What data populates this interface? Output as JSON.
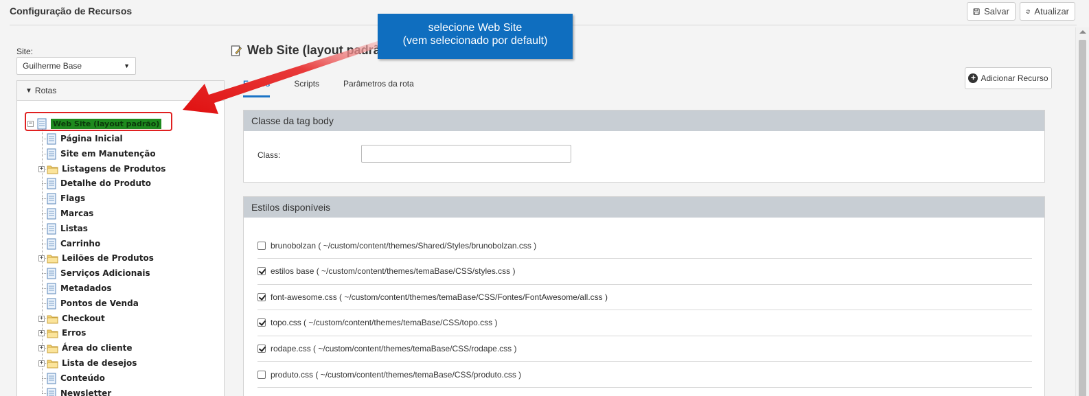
{
  "header": {
    "title": "Configuração de Recursos",
    "save_label": "Salvar",
    "refresh_label": "Atualizar"
  },
  "site": {
    "label": "Site:",
    "selected": "Guilherme Base"
  },
  "tree": {
    "header": "Rotas",
    "root": "Web Site (layout padrão)",
    "items": [
      {
        "label": "Página Inicial",
        "type": "page"
      },
      {
        "label": "Site em Manutenção",
        "type": "page"
      },
      {
        "label": "Listagens de Produtos",
        "type": "folder"
      },
      {
        "label": "Detalhe do Produto",
        "type": "page"
      },
      {
        "label": "Flags",
        "type": "page"
      },
      {
        "label": "Marcas",
        "type": "page"
      },
      {
        "label": "Listas",
        "type": "page"
      },
      {
        "label": "Carrinho",
        "type": "page"
      },
      {
        "label": "Leilões de Produtos",
        "type": "folder"
      },
      {
        "label": "Serviços Adicionais",
        "type": "page"
      },
      {
        "label": "Metadados",
        "type": "page"
      },
      {
        "label": "Pontos de Venda",
        "type": "page"
      },
      {
        "label": "Checkout",
        "type": "folder"
      },
      {
        "label": "Erros",
        "type": "folder"
      },
      {
        "label": "Área do cliente",
        "type": "folder"
      },
      {
        "label": "Lista de desejos",
        "type": "folder"
      },
      {
        "label": "Conteúdo",
        "type": "page"
      },
      {
        "label": "Newsletter",
        "type": "page"
      }
    ]
  },
  "main": {
    "title": "Web Site (layout padrão)",
    "tabs": [
      "Estilos",
      "Scripts",
      "Parâmetros da rota"
    ],
    "active_tab": "Estilos",
    "add_resource_label": "Adicionar Recurso",
    "body_class_panel": {
      "title": "Classe da tag body",
      "class_label": "Class:",
      "class_value": ""
    },
    "styles_panel": {
      "title": "Estilos disponíveis",
      "items": [
        {
          "label": "brunobolzan ( ~/custom/content/themes/Shared/Styles/brunobolzan.css )",
          "checked": false
        },
        {
          "label": "estilos base ( ~/custom/content/themes/temaBase/CSS/styles.css )",
          "checked": true
        },
        {
          "label": "font-awesome.css ( ~/custom/content/themes/temaBase/CSS/Fontes/FontAwesome/all.css )",
          "checked": true
        },
        {
          "label": "topo.css ( ~/custom/content/themes/temaBase/CSS/topo.css )",
          "checked": true
        },
        {
          "label": "rodape.css ( ~/custom/content/themes/temaBase/CSS/rodape.css )",
          "checked": true
        },
        {
          "label": "produto.css ( ~/custom/content/themes/temaBase/CSS/produto.css )",
          "checked": false
        }
      ]
    }
  },
  "callout": {
    "line1": "selecione Web Site",
    "line2": "(vem selecionado por default)"
  },
  "colors": {
    "accent": "#1a73c6",
    "callout_bg": "#0f6ebf",
    "highlight_red": "#e02020",
    "root_green": "#1e8a1e",
    "panel_header": "#c8ced4"
  }
}
